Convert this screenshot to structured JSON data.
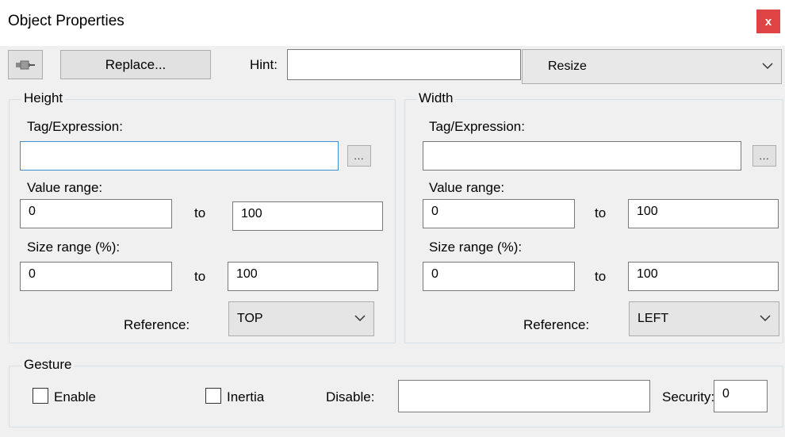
{
  "window": {
    "title": "Object Properties",
    "close_label": "x"
  },
  "toolbar": {
    "pin_icon": "pushpin-icon",
    "replace_label": "Replace...",
    "hint_label": "Hint:",
    "hint_value": "",
    "mode_value": "Resize"
  },
  "height": {
    "group_label": "Height",
    "tag_label": "Tag/Expression:",
    "tag_value": "",
    "browse_label": "...",
    "value_range_label": "Value range:",
    "value_min": "0",
    "value_to": "to",
    "value_max": "100",
    "size_range_label": "Size range (%):",
    "size_min": "0",
    "size_to": "to",
    "size_max": "100",
    "reference_label": "Reference:",
    "reference_value": "TOP"
  },
  "width": {
    "group_label": "Width",
    "tag_label": "Tag/Expression:",
    "tag_value": "",
    "browse_label": "...",
    "value_range_label": "Value range:",
    "value_min": "0",
    "value_to": "to",
    "value_max": "100",
    "size_range_label": "Size range (%):",
    "size_min": "0",
    "size_to": "to",
    "size_max": "100",
    "reference_label": "Reference:",
    "reference_value": "LEFT"
  },
  "gesture": {
    "group_label": "Gesture",
    "enable_label": "Enable",
    "enable_checked": false,
    "inertia_label": "Inertia",
    "inertia_checked": false,
    "disable_label": "Disable:",
    "disable_value": "",
    "security_label": "Security:",
    "security_value": "0"
  },
  "colors": {
    "accent": "#3c8fd6",
    "close": "#e04343",
    "background": "#f0f0f0"
  }
}
